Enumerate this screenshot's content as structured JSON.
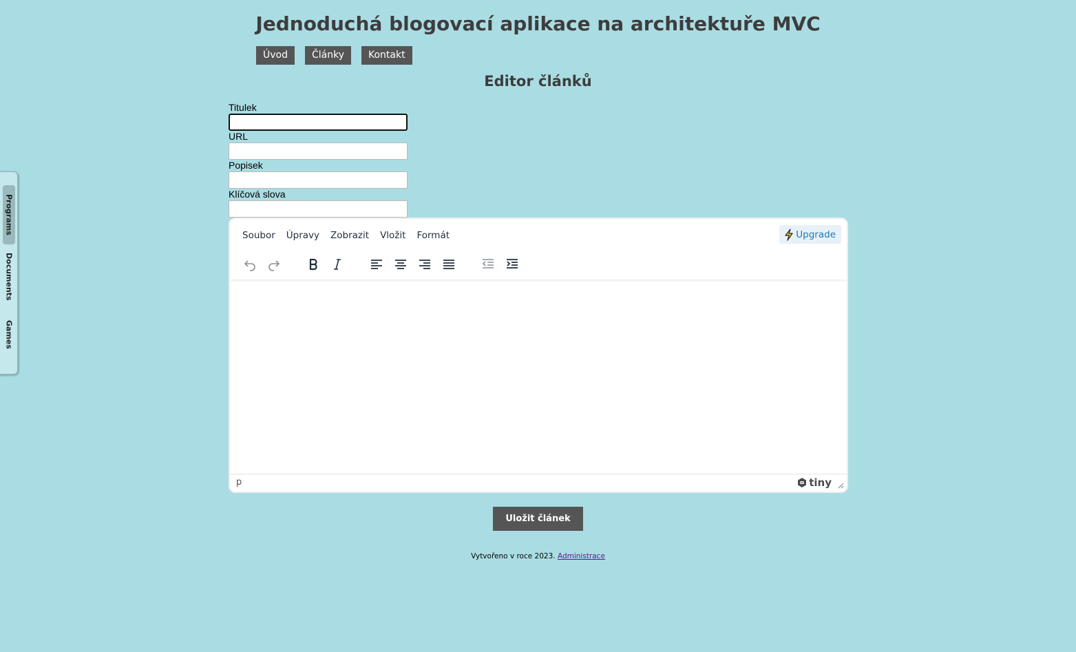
{
  "header": {
    "site_title": "Jednoduchá blogovací aplikace na architektuře MVC"
  },
  "nav": {
    "items": [
      "Úvod",
      "Články",
      "Kontakt"
    ]
  },
  "page": {
    "heading": "Editor článků"
  },
  "form": {
    "title_label": "Titulek",
    "title_value": "",
    "url_label": "URL",
    "url_value": "",
    "description_label": "Popisek",
    "description_value": "",
    "keywords_label": "Klíčová slova",
    "keywords_value": ""
  },
  "side_panel": {
    "tabs": [
      "Programs",
      "Documents",
      "Games"
    ],
    "active_tab": "Programs"
  },
  "editor": {
    "menu": [
      "Soubor",
      "Úpravy",
      "Zobrazit",
      "Vložit",
      "Formát"
    ],
    "upgrade_label": "Upgrade",
    "toolbar_icons": [
      "undo-icon",
      "redo-icon",
      "bold-icon",
      "italic-icon",
      "align-left-icon",
      "align-center-icon",
      "align-right-icon",
      "align-justify-icon",
      "outdent-icon",
      "indent-icon"
    ],
    "status_path": "p",
    "brand": "tiny",
    "colors": {
      "menu_text": "#222f3e",
      "upgrade_text": "#207ab7",
      "upgrade_bg": "#e8f1f8"
    }
  },
  "actions": {
    "save_label": "Uložit článek"
  },
  "footer": {
    "text": "Vytvořeno v roce 2023.",
    "link_label": "Administrace"
  },
  "colors": {
    "page_background": "#aadde3",
    "button_background": "#555555",
    "heading_text": "#3d3d3d"
  }
}
